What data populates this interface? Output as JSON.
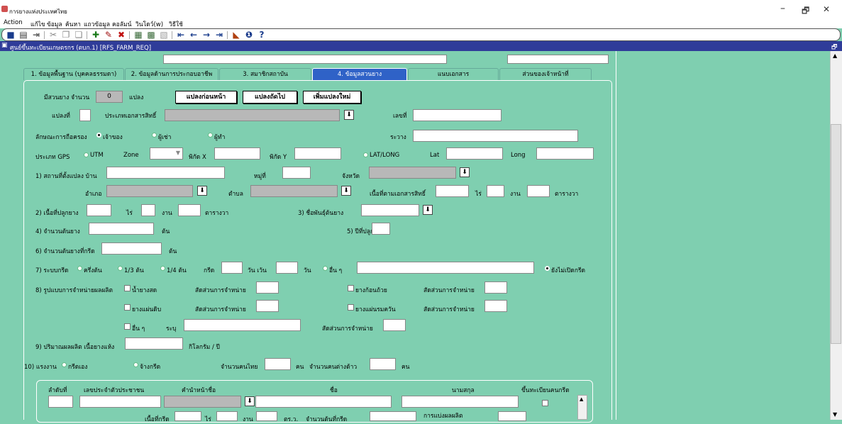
{
  "window": {
    "title": "การยางแห่งประเทศไทย",
    "min": "–",
    "max": "🗗",
    "close": "✕"
  },
  "menu": [
    "Action",
    "แก้ไข",
    "ข้อมูล",
    "ค้นหา",
    "แถวข้อมูล",
    "คอลัมน์",
    "วินโดว์(w)",
    "วิธีใช้"
  ],
  "mdi": {
    "title": "ศูนย์ขึ้นทะเบียนเกษตรกร (ตบก.1) [RFS_FARM_REQ]",
    "restore": "🗗"
  },
  "tabs": [
    "1. ข้อมูลพื้นฐาน (บุคคลธรรมดา)",
    "2. ข้อมูลด้านการประกอบอาชีพ",
    "3. สมาชิกสถาบัน",
    "4. ข้อมูลสวนยาง",
    "แนบเอกสาร",
    "ส่วนของเจ้าหน้าที่"
  ],
  "rubber": {
    "count_label": "มีสวนยาง จำนวน",
    "count": "0",
    "plot_unit": "แปลง",
    "prev": "แปลงก่อนหน้า",
    "next": "แปลงถัดไป",
    "add": "เพิ่มแปลงใหม่"
  },
  "plot": {
    "no_label": "แปลงที่",
    "doc_type": "ประเภทเอกสารสิทธิ์",
    "doc_no": "เลขที่"
  },
  "holding": {
    "label": "ลักษณะการถือครอง",
    "owner": "เจ้าของ",
    "renter": "ผู้เช่า",
    "worker": "ผู้ทำ",
    "range": "ระวาง"
  },
  "gps": {
    "label": "ประเภท GPS",
    "utm": "UTM",
    "zone": "Zone",
    "x": "พิกัด X",
    "y": "พิกัด Y",
    "latlong": "LAT/LONG",
    "lat": "Lat",
    "long": "Long"
  },
  "loc": {
    "l1": "1) สถานที่ตั้งแปลง บ้าน",
    "moo": "หมู่ที่",
    "province": "จังหวัด",
    "amphoe": "อำเภอ",
    "tambon": "ตำบล",
    "area_doc": "เนื้อที่ตามเอกสารสิทธิ์",
    "rai": "ไร่",
    "ngan": "งาน",
    "wa": "ตารางวา"
  },
  "plant": {
    "l2": "2) เนื้อที่ปลูกยาง",
    "rai": "ไร่",
    "ngan": "งาน",
    "wa": "ตารางวา",
    "l3": "3) ชื่อพันธุ์ต้นยาง",
    "l4": "4) จำนวนต้นยาง",
    "tree": "ต้น",
    "l5": "5) ปีที่ปลูก",
    "l6": "6) จำนวนต้นยางที่กรีด",
    "tree2": "ต้น"
  },
  "tap": {
    "l7": "7) ระบบกรีด",
    "half": "ครึ่งต้น",
    "third": "1/3 ต้น",
    "quarter": "1/4 ต้น",
    "cut": "กรีด",
    "day": "วัน เว้น",
    "day2": "วัน",
    "other": "อื่น ๆ",
    "notyet": "ยังไม่เปิดกรีด"
  },
  "sell": {
    "l8": "8) รูปแบบการจำหน่ายผลผลิต",
    "latex": "น้ำยางสด",
    "ratio": "สัดส่วนการจำหน่าย",
    "cup": "ยางก้อนถ้วย",
    "sheet": "ยางแผ่นดิบ",
    "smoked": "ยางแผ่นรมควัน",
    "other": "อื่น ๆ",
    "specify": "ระบุ"
  },
  "yield": {
    "l9": "9) ปริมาณผลผลิต เนื้อยางแห้ง",
    "unit": "กิโลกรัม / ปี"
  },
  "labor": {
    "l10": "10) แรงงาน",
    "self": "กรีดเอง",
    "hired": "จ้างกรีด",
    "thai": "จำนวนคนไทย",
    "person": "คน",
    "foreign": "จำนวนคนต่างด้าว",
    "person2": "คน"
  },
  "grid": {
    "h1": "ลำดับที่",
    "h2": "เลขประจำตัวประชาชน",
    "h3": "คำนำหน้าชื่อ",
    "h4": "ชื่อ",
    "h5": "นามสกุล",
    "h6": "ขึ้นทะเบียนคนกรีด",
    "area": "เนื้อที่กรีด",
    "rai": "ไร่",
    "ngan": "งาน",
    "wa": "ตร.ว.",
    "trees": "จำนวนต้นที่กรีด",
    "share": "การแบ่งผลผลิต"
  }
}
